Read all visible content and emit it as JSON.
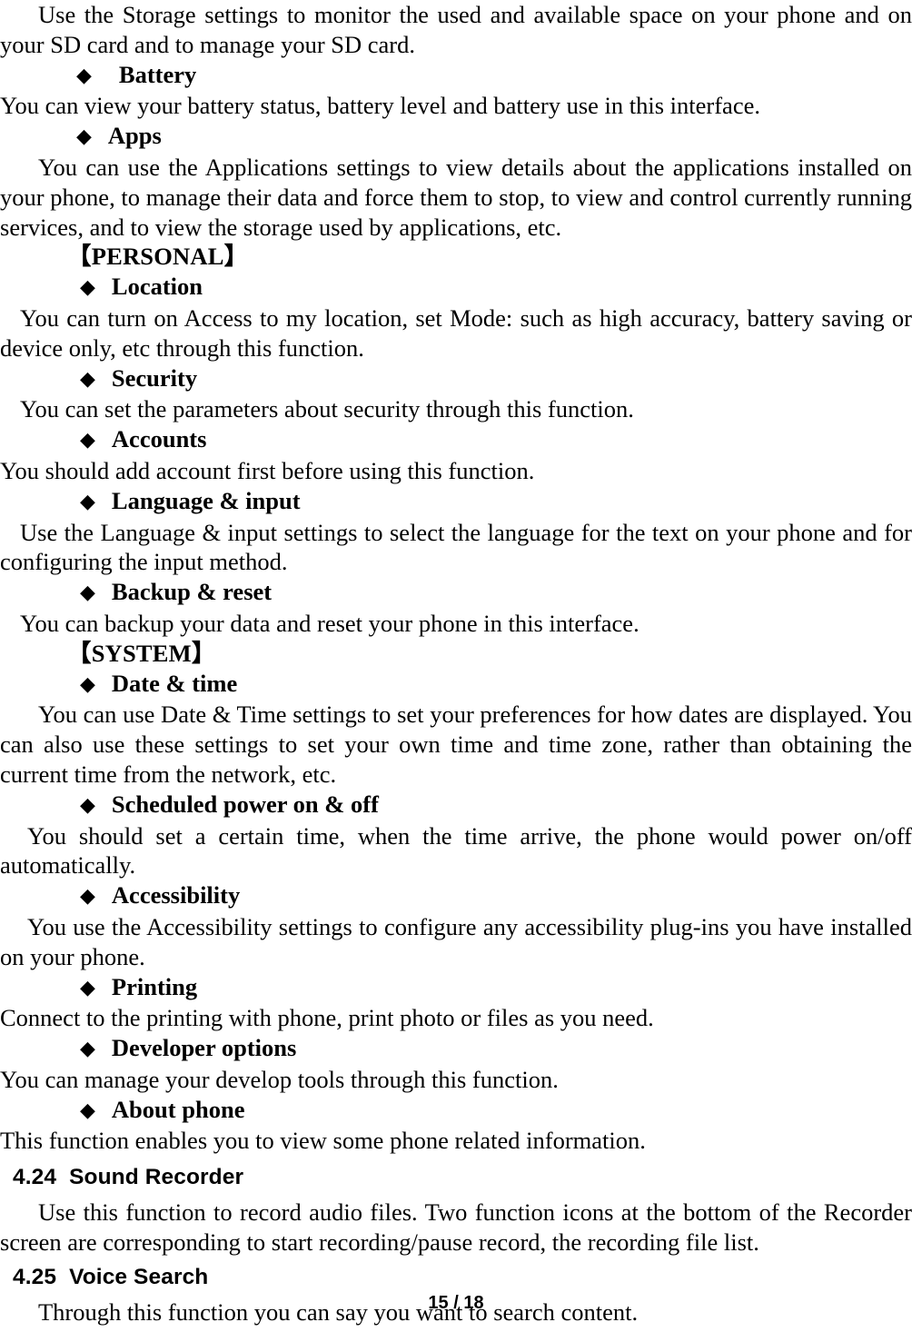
{
  "document": {
    "page_label": "15 / 18",
    "bullet_glyph": "◆",
    "bracket_open": "【",
    "bracket_close": "】"
  },
  "content": {
    "storage_para": "Use the Storage settings to monitor the used and available space on your phone and on your SD card and to manage your SD card.",
    "battery_bullet": "Battery",
    "battery_para": "You can view your battery status, battery level and battery use in this interface.",
    "apps_bullet": "Apps",
    "apps_para": "You can use the Applications settings to view details about the applications installed on your phone, to manage their data and force them to stop, to view and control currently running services, and to view the storage used by applications, etc.",
    "personal_group": "【PERSONAL】",
    "location_bullet": "Location",
    "location_para": "You can turn on Access to my location, set Mode: such as high accuracy, battery saving or device only, etc through this function.",
    "security_bullet": "Security",
    "security_para": "You can set the parameters about security through this function.",
    "accounts_bullet": "Accounts",
    "accounts_para": "You should add account first before using this function.",
    "language_bullet": "Language & input",
    "language_para": "Use the Language & input settings to select the language for the text on your phone and for configuring the input method.",
    "backup_bullet": "Backup & reset",
    "backup_para": "You can backup your data and reset your phone in this interface.",
    "system_group": "【SYSTEM】",
    "datetime_bullet": "Date & time",
    "datetime_para": "You can use Date & Time settings to set your preferences for how dates are displayed. You can also use these settings to set your own time and time zone, rather than obtaining the current time from the network, etc.",
    "scheduled_bullet": "Scheduled power on & off",
    "scheduled_para": "You should set a certain time, when the time arrive, the phone would power on/off automatically.",
    "accessibility_bullet": "Accessibility",
    "accessibility_para": "You use the Accessibility settings to configure any accessibility plug-ins you have installed on your phone.",
    "printing_bullet": "Printing",
    "printing_para": "Connect to the printing with phone, print photo or files as you need.",
    "developer_bullet": "Developer options",
    "developer_para": "You can manage your develop tools through this function.",
    "about_bullet": "About phone",
    "about_para": "This function enables you to view some phone related information."
  },
  "sections": {
    "sound_recorder": {
      "number": "4.24",
      "title": "Sound Recorder",
      "body": "Use this function to record audio files. Two function icons at the bottom of the Recorder screen are corresponding to start recording/pause record, the recording file list."
    },
    "voice_search": {
      "number": "4.25",
      "title": "Voice Search",
      "body": "Through this function you can say you want to search content."
    }
  }
}
